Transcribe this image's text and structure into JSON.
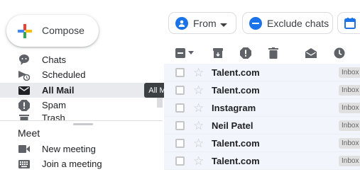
{
  "compose": {
    "label": "Compose"
  },
  "sidebar": {
    "items": [
      {
        "label": "Chats",
        "icon": "chat-icon"
      },
      {
        "label": "Scheduled",
        "icon": "scheduled-icon"
      },
      {
        "label": "All Mail",
        "icon": "mail-icon",
        "active": true
      },
      {
        "label": "Spam",
        "icon": "spam-icon"
      },
      {
        "label": "Trash",
        "icon": "trash-icon"
      }
    ]
  },
  "tooltip": {
    "text": "All Mail"
  },
  "meet": {
    "heading": "Meet",
    "items": [
      {
        "label": "New meeting",
        "icon": "videocam-icon"
      },
      {
        "label": "Join a meeting",
        "icon": "keyboard-icon"
      }
    ]
  },
  "filters": {
    "from_label": "From",
    "exclude_chats_label": "Exclude chats"
  },
  "emails": [
    {
      "sender": "Talent.com",
      "label": "Inbox"
    },
    {
      "sender": "Talent.com",
      "label": "Inbox"
    },
    {
      "sender": "Instagram",
      "label": "Inbox"
    },
    {
      "sender": "Neil Patel",
      "label": "Inbox"
    },
    {
      "sender": "Talent.com",
      "label": "Inbox"
    },
    {
      "sender": "Talent.com",
      "label": "Inbox"
    }
  ],
  "colors": {
    "accent": "#1a73e8",
    "active_nav_bg": "#e8eaed",
    "row_bg": "#f2f6fc",
    "tooltip_bg": "#3c4043"
  }
}
